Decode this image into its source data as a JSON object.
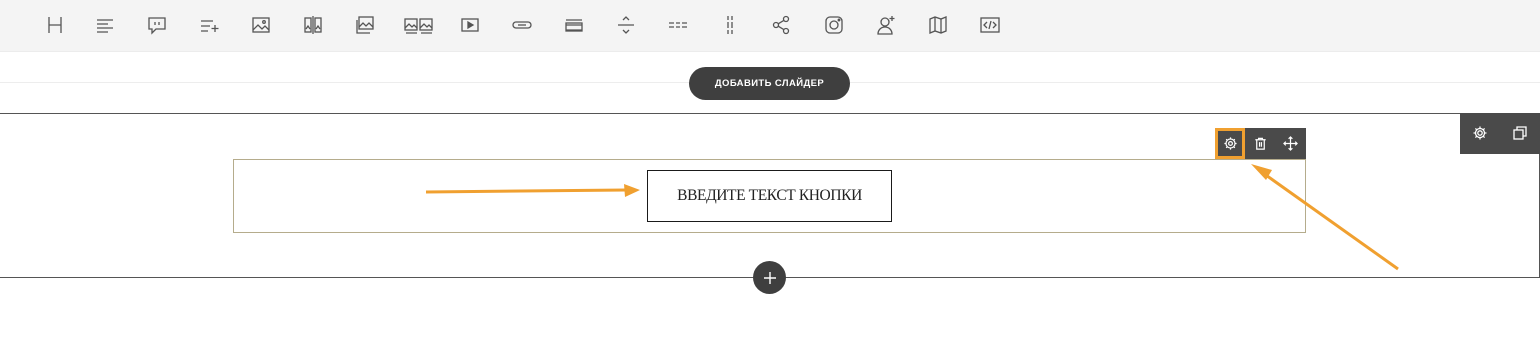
{
  "toolbar": {
    "tools": [
      {
        "icon": "heading-icon"
      },
      {
        "icon": "text-align-icon"
      },
      {
        "icon": "quote-icon"
      },
      {
        "icon": "list-add-icon"
      },
      {
        "icon": "image-icon"
      },
      {
        "icon": "image-compare-icon"
      },
      {
        "icon": "gallery-icon"
      },
      {
        "icon": "double-image-icon"
      },
      {
        "icon": "video-icon"
      },
      {
        "icon": "button-icon"
      },
      {
        "icon": "lines-icon"
      },
      {
        "icon": "divider-icon"
      },
      {
        "icon": "dashed-divider-icon"
      },
      {
        "icon": "vertical-divider-icon"
      },
      {
        "icon": "share-icon"
      },
      {
        "icon": "instagram-icon"
      },
      {
        "icon": "add-user-icon"
      },
      {
        "icon": "map-icon"
      },
      {
        "icon": "code-icon"
      }
    ]
  },
  "add_slider_label": "ДОБАВИТЬ СЛАЙДЕР",
  "text_button_label": "ВВЕДИТЕ ТЕКСТ КНОПКИ",
  "colors": {
    "accent": "#f0a030",
    "dark": "#3f3f3f",
    "element_border": "#b5ac8c"
  }
}
